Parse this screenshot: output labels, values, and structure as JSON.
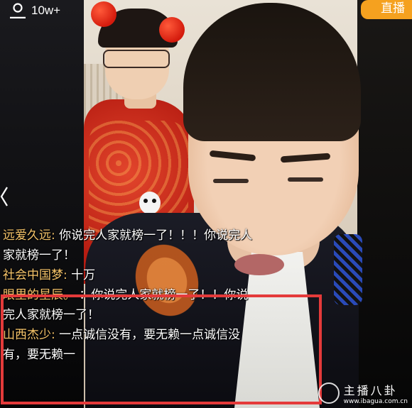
{
  "viewer_count": "10w+",
  "live_button_label": "直播",
  "comments": [
    {
      "user": "远爱久远:",
      "text": "你说完人家就榜一了！！！你说完人"
    },
    {
      "user": "",
      "text": "家就榜一了！"
    },
    {
      "user": "社会中国梦:",
      "text": "十万"
    },
    {
      "user": "眼里的星辰。",
      "text": "：你说完人家就榜一了！！你说"
    },
    {
      "user": "",
      "text": "完人家就榜一了！"
    },
    {
      "user": "山西杰少:",
      "text": "一点诚信没有，要无赖一点诚信没"
    },
    {
      "user": "",
      "text": "有，要无赖一"
    }
  ],
  "watermark": {
    "title": "主播八卦",
    "url": "www.ibagua.com.cn"
  },
  "colors": {
    "live_button": "#f5a11f",
    "username": "#f7c56a",
    "highlight_box": "#e43a3a"
  },
  "icons": {
    "viewers": "person-icon",
    "back": "chevron-left-icon",
    "watermark": "camera-logo-icon"
  }
}
